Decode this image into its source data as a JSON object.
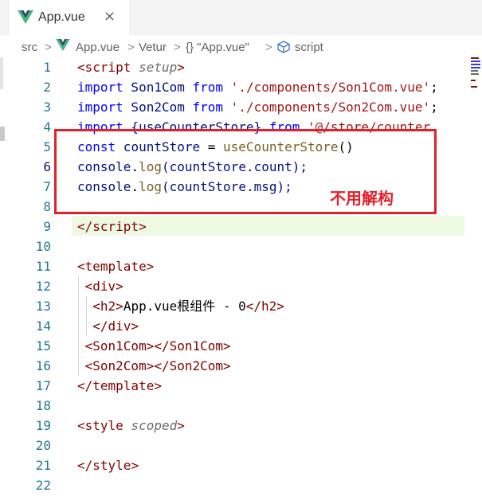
{
  "tab": {
    "label": "App.vue",
    "close": "×"
  },
  "breadcrumb": {
    "items": [
      "src",
      "App.vue",
      "Vetur",
      "{} \"App.vue\"",
      "script"
    ],
    "sep": ">"
  },
  "colors": {
    "tag": "#800000",
    "bracket": "#800000",
    "keyword": "#0000ff",
    "string": "#a31515",
    "ident": "#001080",
    "func": "#795e26",
    "vueGreen": "#41b883",
    "annotation": "#e3202a"
  },
  "editor": {
    "line_numbers": [
      "1",
      "2",
      "3",
      "4",
      "5",
      "6",
      "7",
      "8",
      "9",
      "10",
      "11",
      "12",
      "13",
      "14",
      "15",
      "16",
      "17",
      "18",
      "19",
      "20",
      "21",
      "22"
    ],
    "active_line": 6,
    "lines": [
      [
        [
          "<",
          "tag"
        ],
        [
          "script",
          "tag"
        ],
        [
          " ",
          ""
        ],
        [
          "setup",
          "attr-italic"
        ],
        [
          ">",
          "tag"
        ]
      ],
      [
        [
          "import",
          "kw"
        ],
        [
          " Son1Com ",
          "id"
        ],
        [
          "from",
          "kw"
        ],
        [
          " ",
          ""
        ],
        [
          "'./components/Son1Com.vue'",
          "str"
        ],
        [
          ";",
          ""
        ]
      ],
      [
        [
          "import",
          "kw"
        ],
        [
          " Son2Com ",
          "id"
        ],
        [
          "from",
          "kw"
        ],
        [
          " ",
          ""
        ],
        [
          "'./components/Son2Com.vue'",
          "str"
        ],
        [
          ";",
          ""
        ]
      ],
      [
        [
          "import",
          "kw"
        ],
        [
          " {useCounterStore} ",
          "id"
        ],
        [
          "from",
          "kw"
        ],
        [
          " ",
          ""
        ],
        [
          "'@/store/counter.",
          "str"
        ]
      ],
      [
        [
          "const",
          "kw"
        ],
        [
          " countStore ",
          "id"
        ],
        [
          "= ",
          ""
        ],
        [
          "useCounterStore",
          "fn"
        ],
        [
          "()",
          ""
        ]
      ],
      [
        [
          "console",
          "id"
        ],
        [
          ".",
          ""
        ],
        [
          "log",
          "fn"
        ],
        [
          "(countStore.count);",
          "id"
        ]
      ],
      [
        [
          "console",
          "id"
        ],
        [
          ".",
          ""
        ],
        [
          "log",
          "fn"
        ],
        [
          "(countStore.msg);",
          "id"
        ]
      ],
      [],
      [
        [
          "</",
          "tag"
        ],
        [
          "script",
          "tag"
        ],
        [
          ">",
          "tag"
        ]
      ],
      [],
      [
        [
          "<",
          "tag"
        ],
        [
          "template",
          "tag"
        ],
        [
          ">",
          "tag"
        ]
      ],
      [
        [
          " <",
          "tag"
        ],
        [
          "div",
          "tag"
        ],
        [
          ">",
          "tag"
        ]
      ],
      [
        [
          "  <",
          "tag"
        ],
        [
          "h2",
          "tag"
        ],
        [
          ">",
          "tag"
        ],
        [
          "App.vue根组件 - 0",
          ""
        ],
        [
          "</",
          "tag"
        ],
        [
          "h2",
          "tag"
        ],
        [
          ">",
          "tag"
        ]
      ],
      [
        [
          "  </",
          "tag"
        ],
        [
          "div",
          "tag"
        ],
        [
          ">",
          "tag"
        ]
      ],
      [
        [
          " <",
          "tag"
        ],
        [
          "Son1Com",
          "tag"
        ],
        [
          "></",
          "tag"
        ],
        [
          "Son1Com",
          "tag"
        ],
        [
          ">",
          "tag"
        ]
      ],
      [
        [
          " <",
          "tag"
        ],
        [
          "Son2Com",
          "tag"
        ],
        [
          "></",
          "tag"
        ],
        [
          "Son2Com",
          "tag"
        ],
        [
          ">",
          "tag"
        ]
      ],
      [
        [
          "</",
          "tag"
        ],
        [
          "template",
          "tag"
        ],
        [
          ">",
          "tag"
        ]
      ],
      [],
      [
        [
          "<",
          "tag"
        ],
        [
          "style",
          "tag"
        ],
        [
          " ",
          ""
        ],
        [
          "scoped",
          "attr-italic"
        ],
        [
          ">",
          "tag"
        ]
      ],
      [],
      [
        [
          "</",
          "tag"
        ],
        [
          "style",
          "tag"
        ],
        [
          ">",
          "tag"
        ]
      ],
      []
    ]
  },
  "annotation": {
    "text": "不用解构"
  }
}
